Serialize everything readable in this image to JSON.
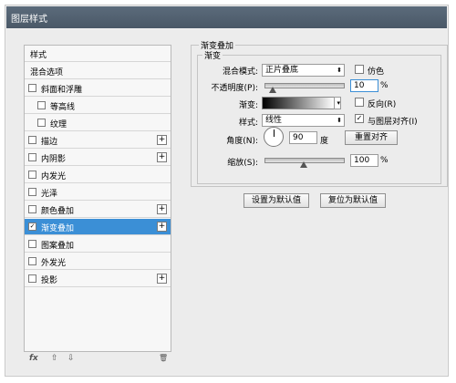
{
  "window": {
    "title": "图层样式"
  },
  "style_list": {
    "items": [
      {
        "label": "样式",
        "checkbox": false,
        "plus": false,
        "selected": false,
        "indent": 0
      },
      {
        "label": "混合选项",
        "checkbox": false,
        "plus": false,
        "selected": false,
        "indent": 0
      },
      {
        "label": "斜面和浮雕",
        "checkbox": true,
        "checked": false,
        "plus": false,
        "selected": false,
        "indent": 0
      },
      {
        "label": "等高线",
        "checkbox": true,
        "checked": false,
        "plus": false,
        "selected": false,
        "indent": 1
      },
      {
        "label": "纹理",
        "checkbox": true,
        "checked": false,
        "plus": false,
        "selected": false,
        "indent": 1
      },
      {
        "label": "描边",
        "checkbox": true,
        "checked": false,
        "plus": true,
        "selected": false,
        "indent": 0
      },
      {
        "label": "内阴影",
        "checkbox": true,
        "checked": false,
        "plus": true,
        "selected": false,
        "indent": 0
      },
      {
        "label": "内发光",
        "checkbox": true,
        "checked": false,
        "plus": false,
        "selected": false,
        "indent": 0
      },
      {
        "label": "光泽",
        "checkbox": true,
        "checked": false,
        "plus": false,
        "selected": false,
        "indent": 0
      },
      {
        "label": "颜色叠加",
        "checkbox": true,
        "checked": false,
        "plus": true,
        "selected": false,
        "indent": 0
      },
      {
        "label": "渐变叠加",
        "checkbox": true,
        "checked": true,
        "plus": true,
        "selected": true,
        "indent": 0
      },
      {
        "label": "图案叠加",
        "checkbox": true,
        "checked": false,
        "plus": false,
        "selected": false,
        "indent": 0
      },
      {
        "label": "外发光",
        "checkbox": true,
        "checked": false,
        "plus": false,
        "selected": false,
        "indent": 0
      },
      {
        "label": "投影",
        "checkbox": true,
        "checked": false,
        "plus": true,
        "selected": false,
        "indent": 0
      }
    ],
    "footer": {
      "fx": "fx",
      "up": "⇧",
      "down": "⇩",
      "trash": "🗑"
    }
  },
  "panel": {
    "title": "渐变叠加",
    "subtitle": "渐变",
    "blend_mode": {
      "label": "混合模式:",
      "value": "正片叠底"
    },
    "dither": {
      "label": "仿色",
      "checked": false
    },
    "opacity": {
      "label": "不透明度(P):",
      "value": "10",
      "unit": "%",
      "level": 0.1
    },
    "gradient": {
      "label": "渐变:"
    },
    "reverse": {
      "label": "反向(R)",
      "checked": false
    },
    "style": {
      "label": "样式:",
      "value": "线性"
    },
    "align": {
      "label": "与图层对齐(I)",
      "checked": true
    },
    "angle": {
      "label": "角度(N):",
      "value": "90",
      "unit": "度"
    },
    "reset_align_button": "重置对齐",
    "scale": {
      "label": "缩放(S):",
      "value": "100",
      "unit": "%",
      "level": 0.5
    },
    "set_default_button": "设置为默认值",
    "reset_default_button": "复位为默认值"
  },
  "colors": {
    "selection": "#3b8fd6",
    "titlebar": "#4f5e6d"
  }
}
